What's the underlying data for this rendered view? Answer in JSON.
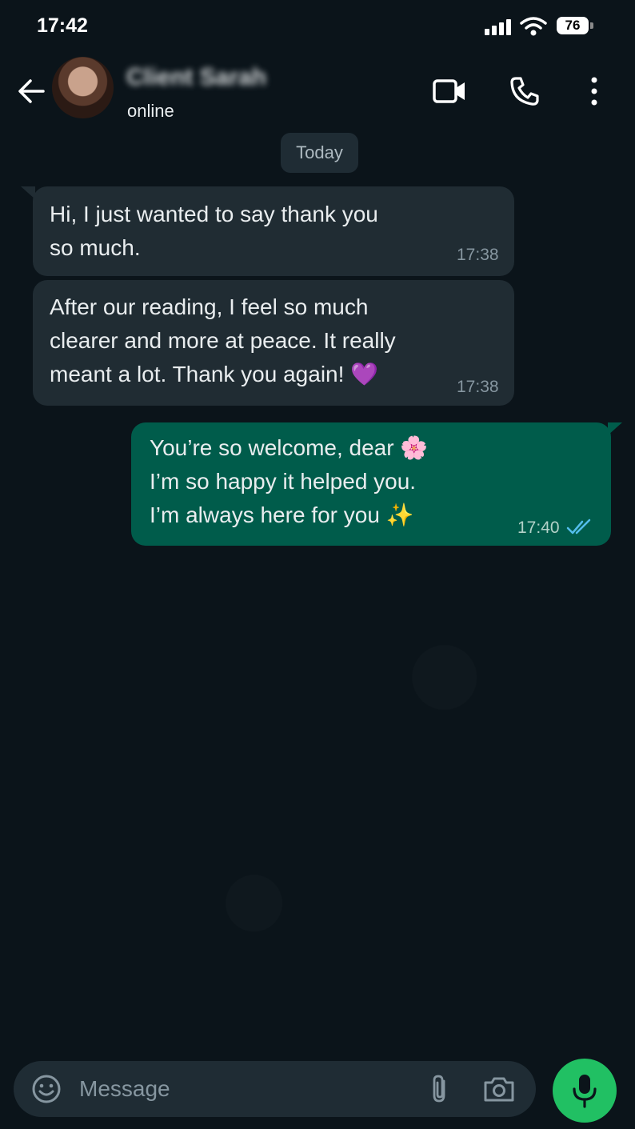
{
  "status_bar": {
    "time": "17:42",
    "battery": "76",
    "icons": [
      "signal-icon",
      "wifi-icon",
      "battery-icon"
    ]
  },
  "header": {
    "contact_name": "Client Sarah",
    "contact_status": "online",
    "icons": [
      "back-arrow-icon",
      "avatar",
      "video-call-icon",
      "phone-icon",
      "more-vertical-icon"
    ]
  },
  "chat": {
    "date_label": "Today",
    "messages": [
      {
        "direction": "incoming",
        "text": "Hi, I just wanted to say thank you\nso much.",
        "time": "17:38"
      },
      {
        "direction": "incoming",
        "text": "After our reading, I feel so much\nclearer and more at peace. It really\nmeant a lot. Thank you again! 💜",
        "time": "17:38"
      },
      {
        "direction": "outgoing",
        "text": "You’re so welcome, dear 🌸\nI’m so happy it helped you.\nI’m always here for you ✨",
        "time": "17:40",
        "read_status": "double-check-read"
      }
    ]
  },
  "composer": {
    "placeholder": "Message",
    "icons": [
      "smiley-icon",
      "paperclip-icon",
      "camera-icon",
      "mic-icon"
    ]
  },
  "colors": {
    "background": "#0b141a",
    "incoming_bubble": "#202c33",
    "outgoing_bubble": "#005c4b",
    "accent": "#21c063",
    "read_tick": "#53bdeb"
  }
}
